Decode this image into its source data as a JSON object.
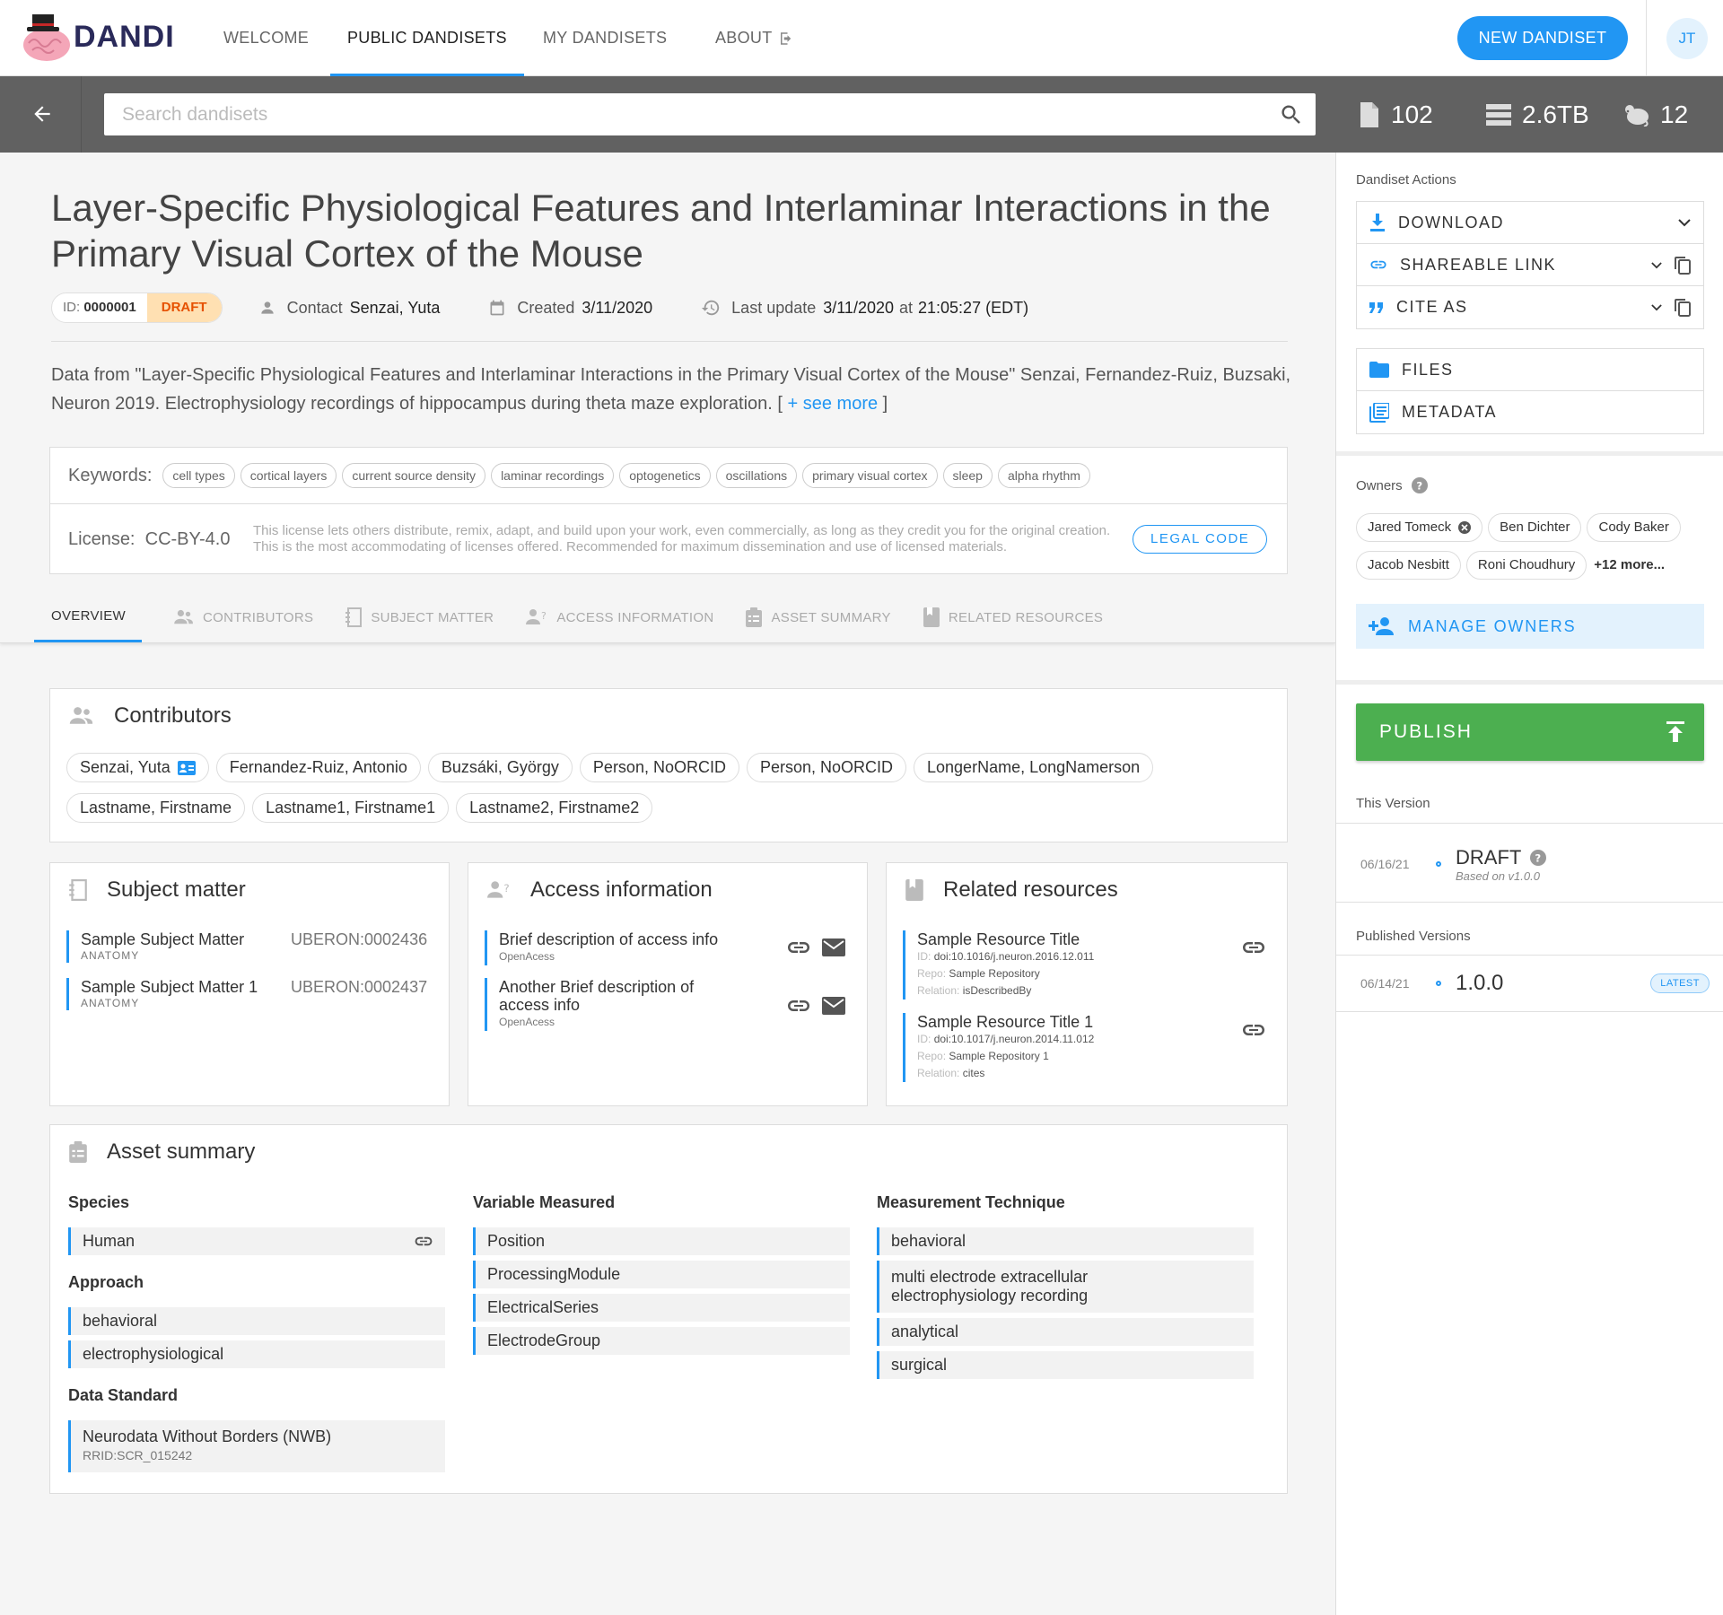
{
  "app": {
    "name": "DANDI"
  },
  "nav": {
    "welcome": "WELCOME",
    "public": "PUBLIC DANDISETS",
    "my": "MY DANDISETS",
    "about": "ABOUT"
  },
  "header": {
    "new_button": "NEW DANDISET",
    "avatar": "JT"
  },
  "search": {
    "placeholder": "Search dandisets"
  },
  "stats": {
    "files": "102",
    "size": "2.6TB",
    "species": "12"
  },
  "dandiset": {
    "title": "Layer-Specific Physiological Features and Interlaminar Interactions in the Primary Visual Cortex of the Mouse",
    "id_label": "ID:",
    "id": "0000001",
    "status": "DRAFT",
    "contact_label": "Contact",
    "contact": "Senzai, Yuta",
    "created_label": "Created",
    "created": "3/11/2020",
    "updated_label": "Last update",
    "updated_date": "3/11/2020",
    "updated_at": "at",
    "updated_time": "21:05:27 (EDT)",
    "description": "Data from \"Layer-Specific Physiological Features and Interlaminar Interactions in the Primary Visual Cortex of the Mouse\" Senzai, Fernandez-Ruiz, Buzsaki, Neuron 2019. Electrophysiology recordings of hippocampus during theta maze exploration.",
    "see_more_open": "[",
    "see_more": "+ see more",
    "see_more_close": "]",
    "keywords_label": "Keywords:",
    "keywords": [
      "cell types",
      "cortical layers",
      "current source density",
      "laminar recordings",
      "optogenetics",
      "oscillations",
      "primary visual cortex",
      "sleep",
      "alpha rhythm"
    ],
    "license_label": "License:",
    "license": "CC-BY-4.0",
    "license_text": "This license lets others distribute, remix, adapt, and build upon your work, even commercially, as long as they credit you for the original creation. This is the most accommodating of licenses offered. Recommended for maximum dissemination and use of licensed materials.",
    "legal_button": "LEGAL CODE"
  },
  "tabs": [
    "OVERVIEW",
    "CONTRIBUTORS",
    "SUBJECT MATTER",
    "ACCESS INFORMATION",
    "ASSET SUMMARY",
    "RELATED RESOURCES"
  ],
  "contributors": {
    "title": "Contributors",
    "people": [
      "Senzai, Yuta",
      "Fernandez-Ruiz, Antonio",
      "Buzsáki, György",
      "Person, NoORCID",
      "Person, NoORCID",
      "LongerName, LongNamerson",
      "Lastname, Firstname",
      "Lastname1, Firstname1",
      "Lastname2, Firstname2"
    ]
  },
  "subject": {
    "title": "Subject matter",
    "items": [
      {
        "name": "Sample Subject Matter",
        "type": "ANATOMY",
        "code": "UBERON:0002436"
      },
      {
        "name": "Sample Subject Matter 1",
        "type": "ANATOMY",
        "code": "UBERON:0002437"
      }
    ]
  },
  "access": {
    "title": "Access information",
    "items": [
      {
        "desc": "Brief description of access info",
        "status": "OpenAcess"
      },
      {
        "desc": "Another Brief description of access info",
        "status": "OpenAcess"
      }
    ]
  },
  "related": {
    "title": "Related resources",
    "id_label": "ID:",
    "repo_label": "Repo:",
    "relation_label": "Relation:",
    "items": [
      {
        "title": "Sample Resource Title",
        "id": "doi:10.1016/j.neuron.2016.12.011",
        "repo": "Sample Repository",
        "relation": "isDescribedBy"
      },
      {
        "title": "Sample Resource Title 1",
        "id": "doi:10.1017/j.neuron.2014.11.012",
        "repo": "Sample Repository 1",
        "relation": "cites"
      }
    ]
  },
  "asset_summary": {
    "title": "Asset summary",
    "species_label": "Species",
    "species": [
      "Human"
    ],
    "approach_label": "Approach",
    "approach": [
      "behavioral",
      "electrophysiological"
    ],
    "standard_label": "Data Standard",
    "standard": {
      "name": "Neurodata Without Borders (NWB)",
      "rrid": "RRID:SCR_015242"
    },
    "variables_label": "Variable Measured",
    "variables": [
      "Position",
      "ProcessingModule",
      "ElectricalSeries",
      "ElectrodeGroup"
    ],
    "techniques_label": "Measurement Technique",
    "techniques": [
      "behavioral",
      "multi electrode extracellular electrophysiology recording",
      "analytical",
      "surgical"
    ]
  },
  "sidebar": {
    "actions_label": "Dandiset Actions",
    "download": "DOWNLOAD",
    "share": "SHAREABLE LINK",
    "cite": "CITE AS",
    "files": "FILES",
    "metadata": "METADATA",
    "owners_label": "Owners",
    "owners": [
      "Jared Tomeck",
      "Ben Dichter",
      "Cody Baker",
      "Jacob Nesbitt",
      "Roni Choudhury"
    ],
    "more_owners": "+12 more...",
    "manage_owners": "MANAGE OWNERS",
    "publish": "PUBLISH",
    "this_version_label": "This Version",
    "this_version": {
      "date": "06/16/21",
      "name": "DRAFT",
      "based_on": "Based on v1.0.0"
    },
    "published_label": "Published Versions",
    "published": [
      {
        "date": "06/14/21",
        "name": "1.0.0",
        "badge": "LATEST"
      }
    ]
  },
  "colors": {
    "accent": "#2196f3",
    "publish": "#4caf50",
    "draft_bg": "#ffe0b2",
    "draft_text": "#e65100",
    "bar": "#616161"
  }
}
